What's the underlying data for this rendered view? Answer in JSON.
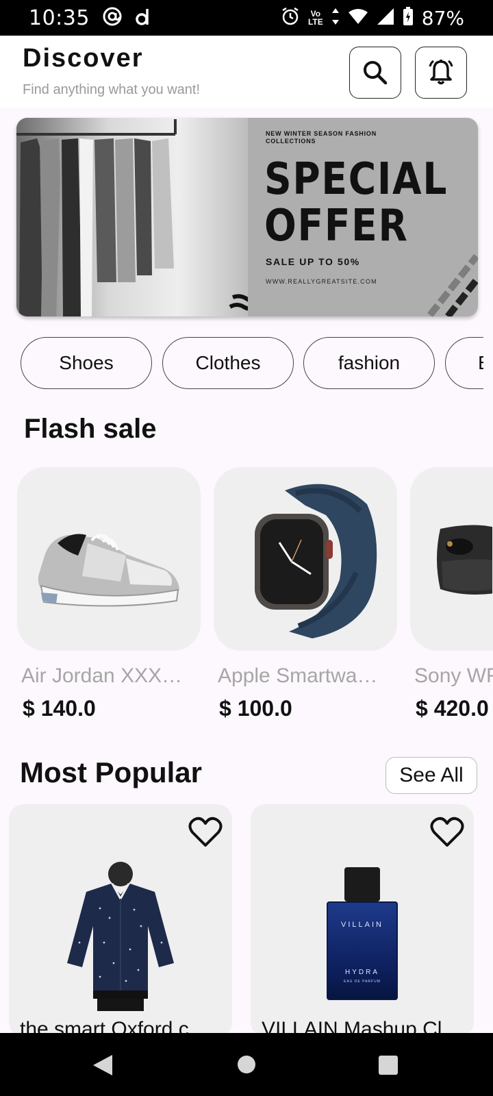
{
  "status_bar": {
    "time": "10:35",
    "volte_top": "Vo",
    "volte_bottom": "LTE",
    "battery": "87%"
  },
  "header": {
    "title": "Discover",
    "subtitle": "Find anything what you want!"
  },
  "banner": {
    "tagline": "NEW WINTER SEASON FASHION COLLECTIONS",
    "headline_line1": "SPECIAL",
    "headline_line2": "OFFER",
    "sale": "SALE UP TO 50%",
    "url": "WWW.REALLYGREATSITE.COM"
  },
  "categories": [
    {
      "label": "Shoes"
    },
    {
      "label": "Clothes"
    },
    {
      "label": "fashion"
    },
    {
      "label": "E"
    }
  ],
  "flash_sale": {
    "title": "Flash sale",
    "items": [
      {
        "name": "Air Jordan XXX…",
        "price": "$ 140.0"
      },
      {
        "name": "Apple Smartwa…",
        "price": "$ 100.0"
      },
      {
        "name": "Sony WF",
        "price": "$ 420.0"
      }
    ]
  },
  "most_popular": {
    "title": "Most Popular",
    "see_all": "See All",
    "items": [
      {
        "name": "the smart Oxford c"
      },
      {
        "name": "VILLAIN Mashup Cl",
        "bottle_brand": "VILLAIN",
        "bottle_name": "HYDRA",
        "bottle_sub": "EAU DE PARFUM"
      }
    ]
  },
  "colors": {
    "background": "#fdf8fd",
    "card": "#efefef",
    "muted_text": "#a6a6a6",
    "status_bar": "#000000"
  }
}
